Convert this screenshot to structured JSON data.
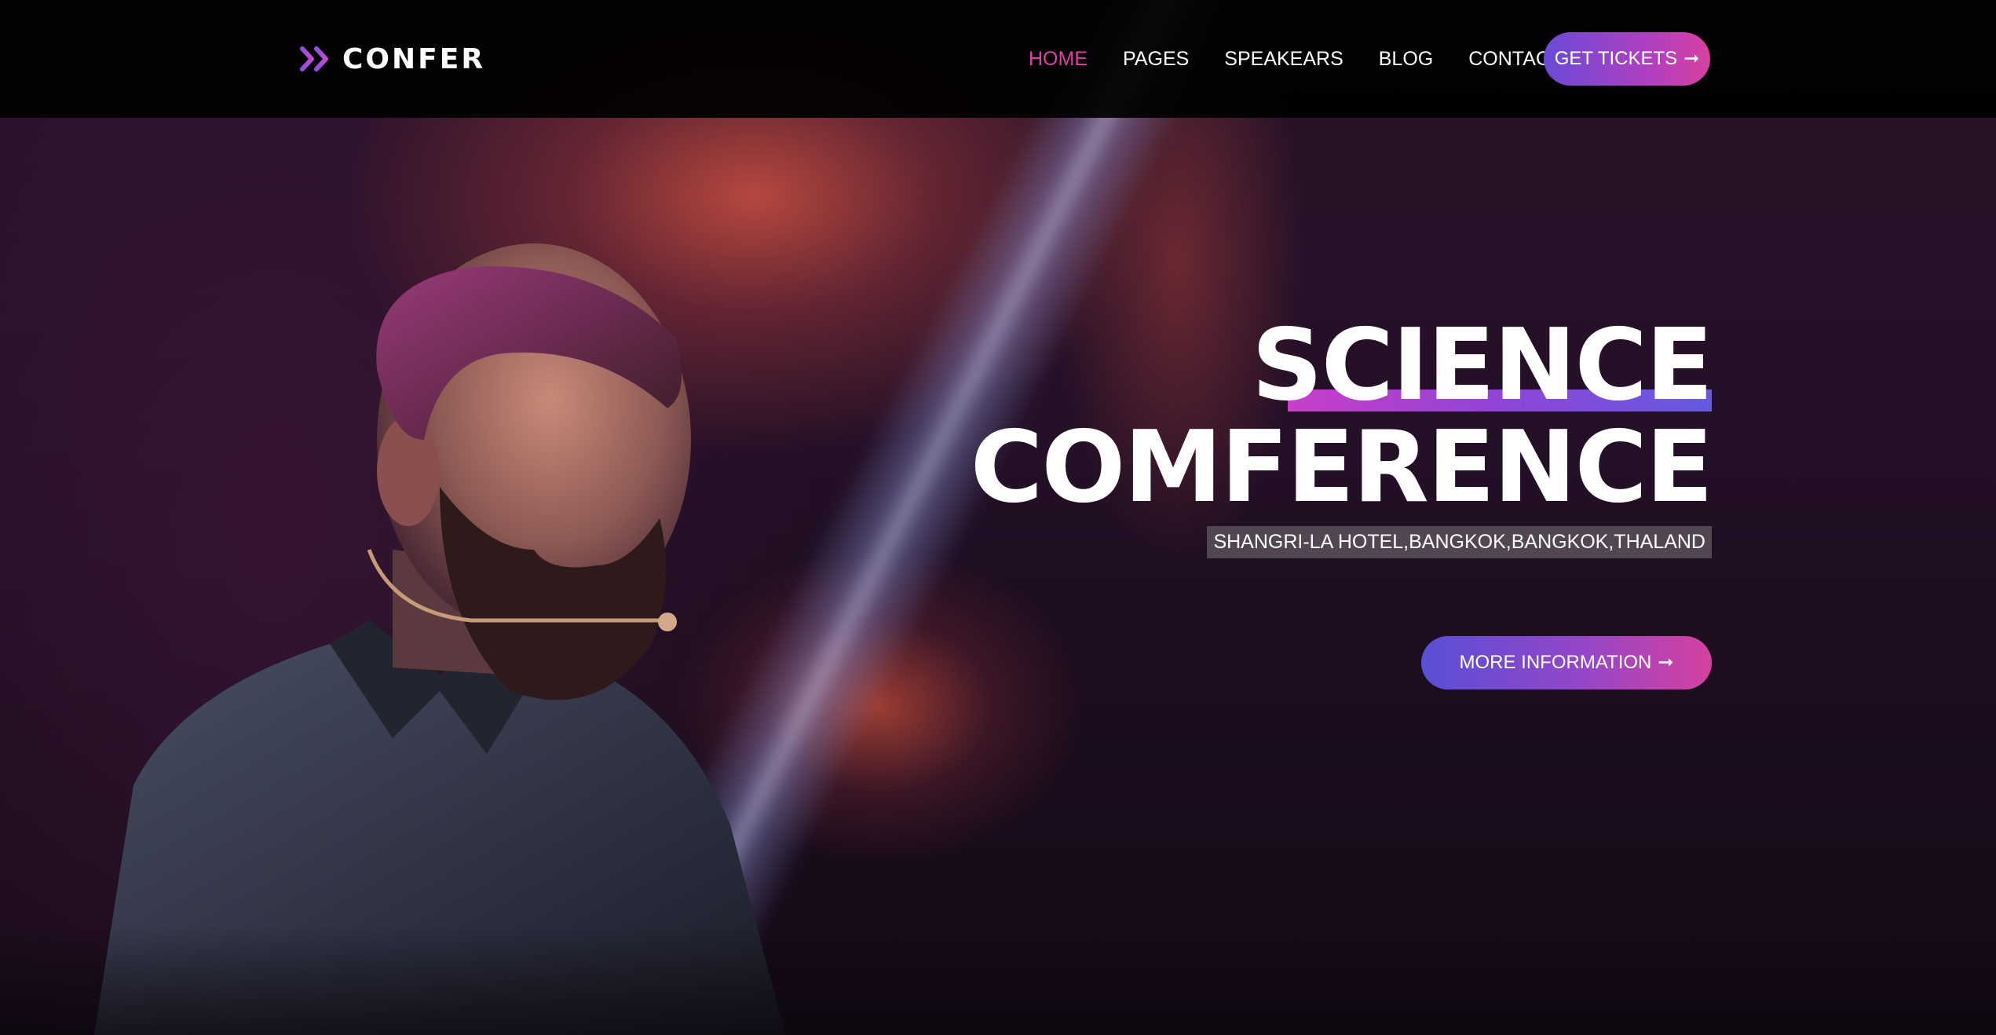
{
  "brand": {
    "logo_text": "CONFER",
    "logo_icon": "double-chevron-right-icon"
  },
  "nav": {
    "items": [
      {
        "label": "HOME",
        "active": true
      },
      {
        "label": "PAGES",
        "active": false
      },
      {
        "label": "SPEAKEARS",
        "active": false
      },
      {
        "label": "BLOG",
        "active": false
      },
      {
        "label": "CONTACT",
        "active": false
      }
    ],
    "cta_label": "GET TICKETS",
    "cta_icon": "arrow-right-icon"
  },
  "hero": {
    "title_line_1": "SCIENCE",
    "title_line_2": "COMFERENCE",
    "location": "SHANGRI-LA HOTEL,BANGKOK,BANGKOK,THALAND",
    "button_label": "MORE INFORMATION",
    "button_icon": "arrow-right-icon"
  },
  "colors": {
    "accent_pink": "#e040a6",
    "accent_purple": "#6a4bd6",
    "navbar_bg": "#000000"
  }
}
